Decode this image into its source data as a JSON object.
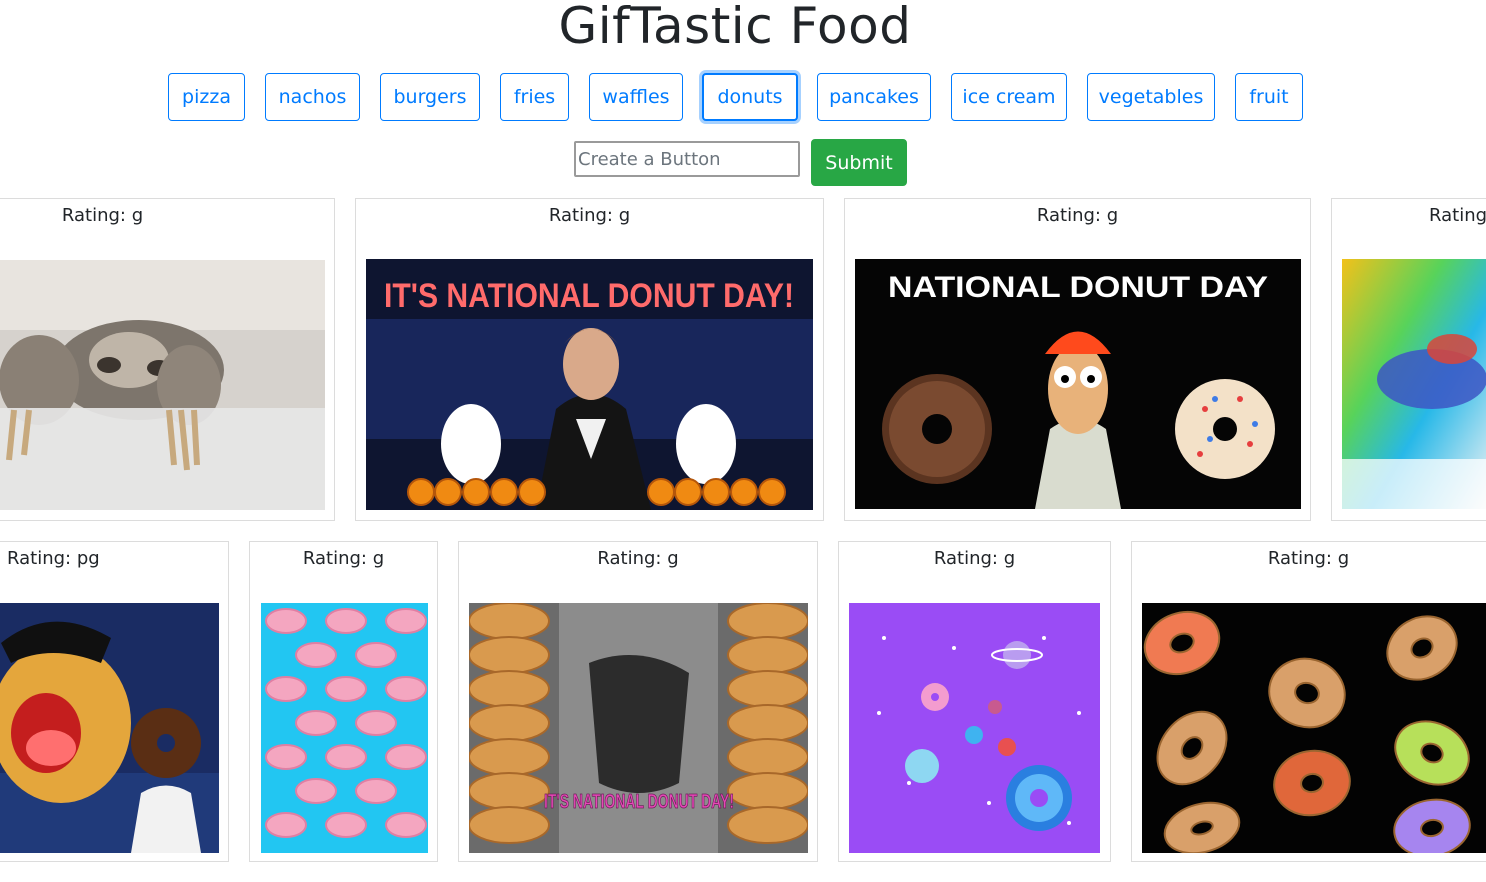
{
  "header": {
    "title": "GifTastic Food"
  },
  "topics": [
    "pizza",
    "nachos",
    "burgers",
    "fries",
    "waffles",
    "donuts",
    "pancakes",
    "ice cream",
    "vegetables",
    "fruit"
  ],
  "active_topic": "donuts",
  "form": {
    "placeholder": "Create a Button",
    "submit_label": "Submit"
  },
  "gifs": [
    {
      "rating": "Rating: g",
      "icon": "sloth-gif",
      "caption": ""
    },
    {
      "rating": "Rating: g",
      "icon": "national-donut-day-gif",
      "caption": "IT'S NATIONAL DONUT DAY!"
    },
    {
      "rating": "Rating: g",
      "icon": "beaker-donut-gif",
      "caption": "NATIONAL DONUT DAY"
    },
    {
      "rating": "Rating",
      "icon": "glitch-gif",
      "caption": ""
    },
    {
      "rating": "Rating: pg",
      "icon": "cartoon-donut-gif",
      "caption": ""
    },
    {
      "rating": "Rating: g",
      "icon": "donut-pattern-gif",
      "caption": ""
    },
    {
      "rating": "Rating: g",
      "icon": "donut-stack-gif",
      "caption": "IT'S NATIONAL DONUT DAY!"
    },
    {
      "rating": "Rating: g",
      "icon": "space-donuts-gif",
      "caption": ""
    },
    {
      "rating": "Rating: g",
      "icon": "flying-donuts-gif",
      "caption": ""
    }
  ],
  "colors": {
    "primary": "#007bff",
    "success": "#28a745"
  }
}
